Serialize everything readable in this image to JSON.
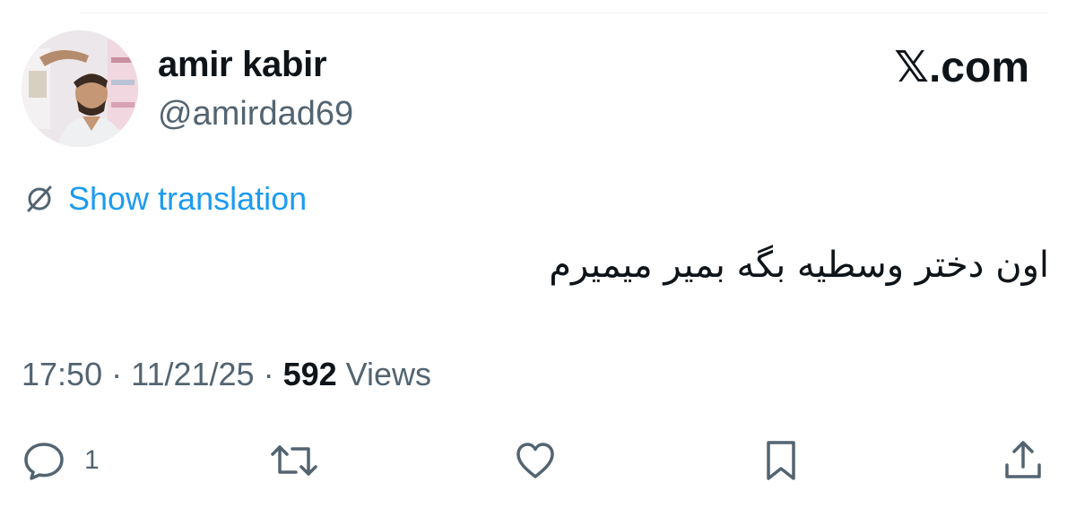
{
  "author": {
    "display_name": "amir kabir",
    "handle": "@amirdad69",
    "avatar": "profile-photo"
  },
  "brand": {
    "label": "𝕏.com"
  },
  "translation": {
    "icon": "translate-icon",
    "label": "Show translation"
  },
  "tweet": {
    "text": "اون دختر وسطیه بگه بمیر میمیرم"
  },
  "meta": {
    "time": "17:50",
    "separator": " · ",
    "date": "11/21/25",
    "views_count": "592",
    "views_label": " Views"
  },
  "actions": {
    "reply": {
      "icon": "reply-icon",
      "count": "1"
    },
    "retweet": {
      "icon": "retweet-icon"
    },
    "like": {
      "icon": "heart-icon"
    },
    "bookmark": {
      "icon": "bookmark-icon"
    },
    "share": {
      "icon": "share-icon"
    }
  },
  "colors": {
    "text": "#0f1419",
    "secondary": "#536471",
    "accent": "#1d9bf0"
  }
}
